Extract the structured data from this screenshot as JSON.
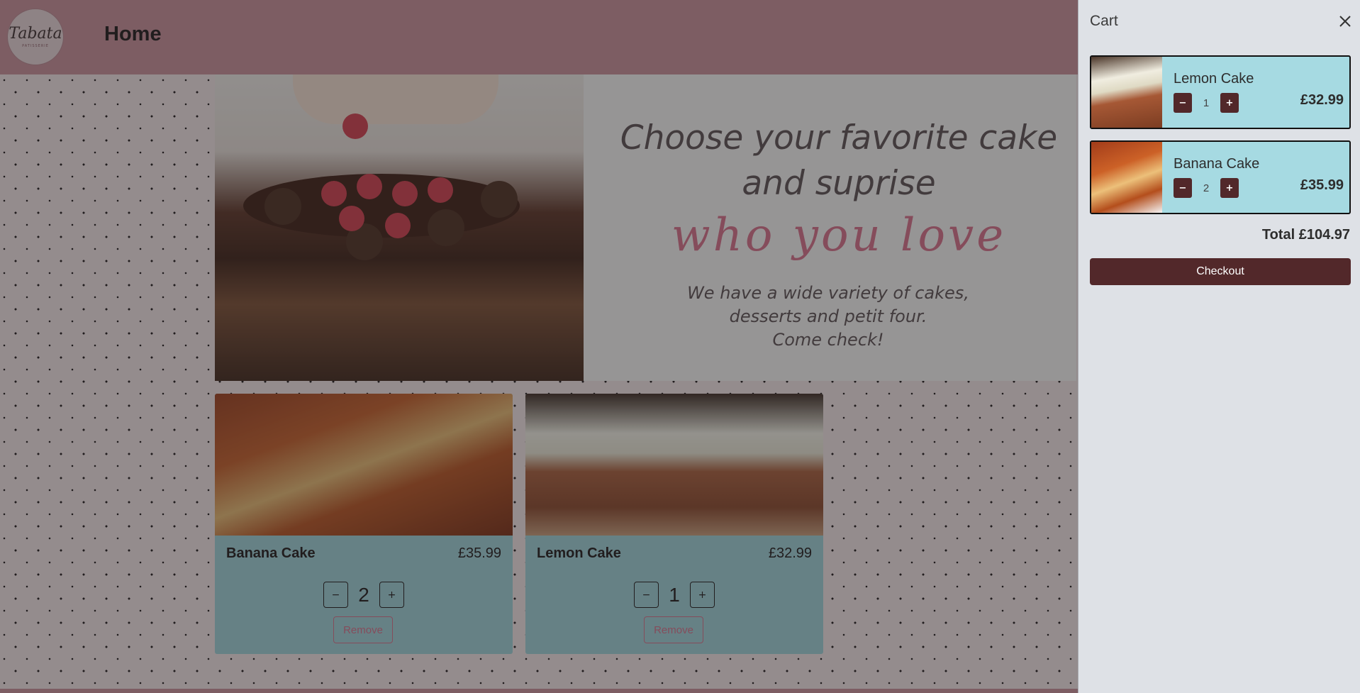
{
  "navbar": {
    "logo_text": "Tabata",
    "logo_subtext": "PATISSERIE",
    "title": "Home"
  },
  "hero": {
    "title_line1": "Choose your favorite cake",
    "title_line2": "and suprise",
    "script_text": "who you love",
    "sub_line1": "We have a wide variety of cakes,",
    "sub_line2": "desserts and petit four.",
    "sub_line3": "Come check!"
  },
  "products": [
    {
      "name": "Banana Cake",
      "price": "£35.99",
      "quantity": "2",
      "minus": "−",
      "plus": "+",
      "remove_label": "Remove"
    },
    {
      "name": "Lemon Cake",
      "price": "£32.99",
      "quantity": "1",
      "minus": "−",
      "plus": "+",
      "remove_label": "Remove"
    }
  ],
  "cart": {
    "title": "Cart",
    "close_icon": "close-icon",
    "items": [
      {
        "name": "Lemon Cake",
        "quantity": "1",
        "price": "£32.99",
        "minus": "−",
        "plus": "+"
      },
      {
        "name": "Banana Cake",
        "quantity": "2",
        "price": "£35.99",
        "minus": "−",
        "plus": "+"
      }
    ],
    "total": "Total £104.97",
    "checkout_label": "Checkout"
  },
  "colors": {
    "navbar": "#c98d98",
    "card": "#9ed0d8",
    "cart_item": "#a6dae2",
    "button_dark": "#52282a",
    "accent_pink": "#d86d89"
  }
}
